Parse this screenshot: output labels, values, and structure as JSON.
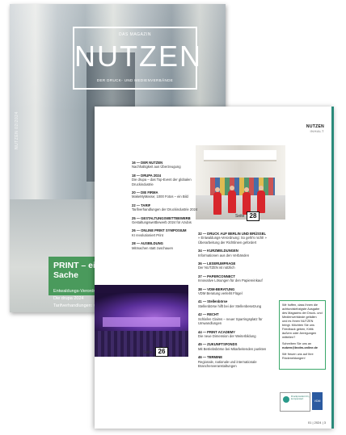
{
  "cover": {
    "vertical_text": "NUTZEN 02/2024",
    "masthead_top": "DAS MAGAZIN",
    "masthead_title": "NUTZEN",
    "masthead_sub": "DER DRUCK- UND MEDIENVERBÄNDE",
    "headline": "PRINT – eine sehr saubere Sache",
    "lines": [
      "Entwaldungs-Verordnung: So geht's nicht!",
      "Die drupa 2024",
      "Tarifverhandlungen: verdi fordert 12 %"
    ]
  },
  "inner": {
    "header_title": "NUTZEN",
    "header_sub": "INHALT",
    "photo_top_label": "Seite",
    "photo_top_page": "28",
    "photo_bottom_label": "Seite",
    "photo_bottom_page": "26",
    "toc_left": [
      {
        "head": "16 — DER NUTZEN",
        "desc": "Nachhaltigkeit aus Überzeugung"
      },
      {
        "head": "18 — DRUPA 2024",
        "desc": "Die drupa – das Top-Event der globalen Druckindustrie"
      },
      {
        "head": "20 — DIE FIRMA",
        "desc": "MakeMyMasse; 1000 Fotos – ein Bild"
      },
      {
        "head": "22 — TARIF",
        "desc": "Tarifverhandlungen der Druckindustrie 2024"
      },
      {
        "head": "25 — GESTALTUNGSWETTBEWERB",
        "desc": "Gestaltungswettbewerb 2024 für Azubis"
      },
      {
        "head": "26 — ONLINE PRINT SYMPOSIUM",
        "desc": "KI revolutioniert Print"
      },
      {
        "head": "28 — AUSBILDUNG",
        "desc": "Mitmachen statt zuschauen"
      }
    ],
    "toc_right": [
      {
        "head": "32 — DRUCK AUF BERLIN UND BRÜSSEL",
        "desc": "» Entwaldungs-Verordnung: So geht's nicht! » Überarbeitung der Richtlinien gefordert"
      },
      {
        "head": "34 — KURZMELDUNGEN",
        "desc": "Informationen aus den Verbänden"
      },
      {
        "head": "36 — LESERUMFRAGE",
        "desc": "Der NUTZEN ist nützlich"
      },
      {
        "head": "37 — PAPERCONNECT",
        "desc": "Innovative Lösungen für den Papiereinkauf"
      },
      {
        "head": "38 — VDM-BERATUNG",
        "desc": "VDM Beratung verleiht Flügel"
      },
      {
        "head": "41 — Stellenbörse",
        "desc": "Stellenbörse hilft bei der Stellenbesetzung"
      },
      {
        "head": "42 — RECHT",
        "desc": "Schlafen Claims – neuer Sparringsplatz für Umwandlungen"
      },
      {
        "head": "44 — PRINT ACADEMY",
        "desc": "Die neue Dimension der Weiterbildung"
      },
      {
        "head": "45 — ZUKUNFTSFONDS",
        "desc": "Mit Betriebsbörse bei Mitarbeitenden punkten"
      },
      {
        "head": "46 — TERMINE",
        "desc": "Regionale, nationale und internationale Branchenveranstaltungen"
      }
    ],
    "feedback_text": "Wir hoffen, dass Ihnen die achtundsiebzigste Ausgabe des Magazins der Druck- und Medienverbände gefallen und es Ihnen NUTZEN bringt. Möchten Sie uns Feedback geben, Kritik äußern oder Anregungen mitteilen?",
    "feedback_contact": "Schreiben Sie uns an",
    "feedback_email": "nutzen@bvdm-online.de",
    "feedback_closing": "Wir freuen uns auf Ihre Rückmeldungen!",
    "badge_text": "Druckprodukt CO₂ kompensiert",
    "badge2_text": "VDM",
    "footer": "01 | 2024 | 3"
  },
  "colors": {
    "cover_box_green": "#4a9a5c",
    "accent_teal": "#2a8a7a",
    "feedback_border": "#3aa86a"
  }
}
